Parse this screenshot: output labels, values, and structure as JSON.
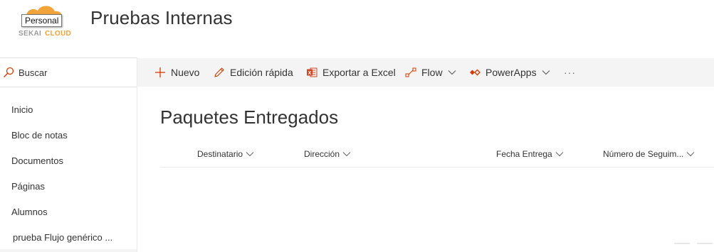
{
  "header": {
    "site_title": "Pruebas Internas",
    "logo_tooltip": "Personal",
    "logo_text_left": "SEKAI",
    "logo_text_right": "CLOUD"
  },
  "leftnav": {
    "search_label": "Buscar",
    "items": [
      {
        "label": "Inicio"
      },
      {
        "label": "Bloc de notas"
      },
      {
        "label": "Documentos"
      },
      {
        "label": "Páginas"
      },
      {
        "label": "Alumnos"
      },
      {
        "label": "prueba Flujo genérico ..."
      }
    ]
  },
  "commandbar": {
    "new_label": "Nuevo",
    "quick_edit_label": "Edición rápida",
    "export_label": "Exportar a Excel",
    "flow_label": "Flow",
    "powerapps_label": "PowerApps",
    "more_label": "···"
  },
  "main": {
    "page_title": "Paquetes Entregados",
    "columns": [
      {
        "label": "Destinatario"
      },
      {
        "label": "Dirección"
      },
      {
        "label": "Fecha Entrega"
      },
      {
        "label": "Número de Seguim..."
      }
    ]
  },
  "colors": {
    "accent": "#d83b01",
    "excel_red": "#d24726",
    "logo_orange": "#f2a33a",
    "commandbar_bg": "#f4f4f4"
  }
}
